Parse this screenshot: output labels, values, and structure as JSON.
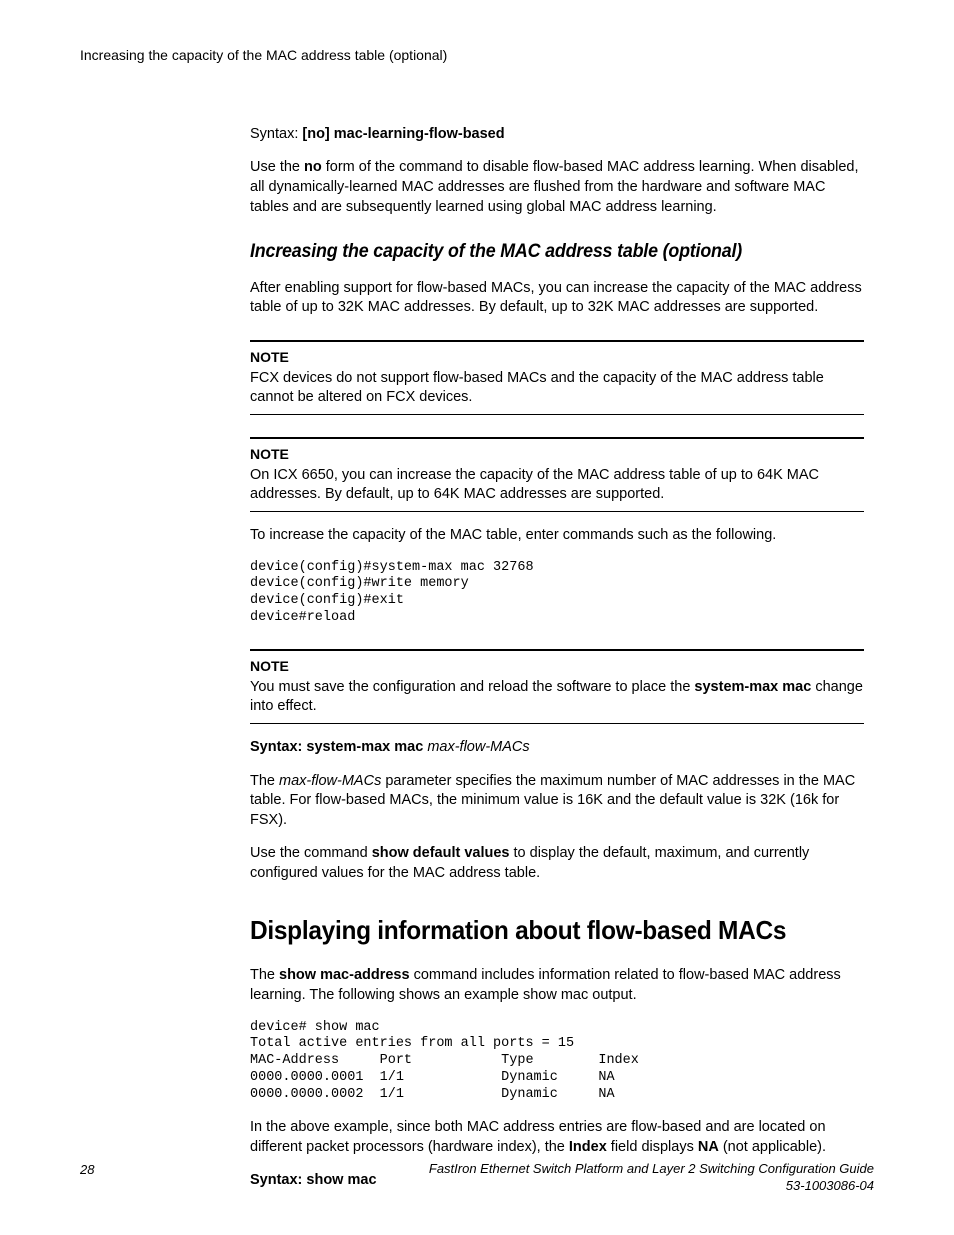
{
  "header": {
    "running_title": "Increasing the capacity of the MAC address table (optional)"
  },
  "block_syntax1": {
    "prefix": "Syntax: ",
    "bold": "[no] mac-learning-flow-based"
  },
  "para_useno_1": "Use the ",
  "para_useno_bold": "no",
  "para_useno_2": " form of the command to disable flow-based MAC address learning. When disabled, all dynamically-learned MAC addresses are flushed from the hardware and software MAC tables and are subsequently learned using global MAC address learning.",
  "section_heading": "Increasing the capacity of the MAC address table (optional)",
  "para_after_enabling": "After enabling support for flow-based MACs, you can increase the capacity of the MAC address table of up to 32K MAC addresses. By default, up to 32K MAC addresses are supported.",
  "note1": {
    "label": "NOTE",
    "body": "FCX devices do not support flow-based MACs and the capacity of the MAC address table cannot be altered on FCX devices."
  },
  "note2": {
    "label": "NOTE",
    "body": "On ICX 6650, you can increase the capacity of the MAC address table of up to 64K MAC addresses. By default, up to 64K MAC addresses are supported."
  },
  "para_to_increase": "To increase the capacity of the MAC table, enter commands such as the following.",
  "code1": "device(config)#system-max mac 32768\ndevice(config)#write memory\ndevice(config)#exit\ndevice#reload",
  "note3": {
    "label": "NOTE",
    "body_1": "You must save the configuration and reload the software to place the ",
    "body_bold": "system-max mac",
    "body_2": " change into effect."
  },
  "syntax2": {
    "bold": "Syntax: system-max mac",
    "italic": " max-flow-MACs"
  },
  "para_maxflow_1": "The ",
  "para_maxflow_italic": "max-flow-MACs",
  "para_maxflow_2": " parameter specifies the maximum number of MAC addresses in the MAC table. For flow-based MACs, the minimum value is 16K and the default value is 32K (16k for FSX).",
  "para_showdefault_1": "Use the command ",
  "para_showdefault_bold": "show default values",
  "para_showdefault_2": " to display the default, maximum, and currently configured values for the MAC address table.",
  "big_heading": "Displaying information about flow-based MACs",
  "para_showmac_1": "The ",
  "para_showmac_bold": "show mac-address",
  "para_showmac_2": " command includes information related to flow-based MAC address learning. The following shows an example show mac output.",
  "code2": "device# show mac\nTotal active entries from all ports = 15\nMAC-Address     Port           Type        Index\n0000.0000.0001  1/1            Dynamic     NA\n0000.0000.0002  1/1            Dynamic     NA",
  "para_example_1": "In the above example, since both MAC address entries are flow-based and are located on different packet processors (hardware index), the ",
  "para_example_bold1": "Index",
  "para_example_2": " field displays ",
  "para_example_bold2": "NA",
  "para_example_3": " (not applicable).",
  "syntax3": "Syntax: show mac",
  "footer": {
    "page": "28",
    "guide_title": "FastIron Ethernet Switch Platform and Layer 2 Switching Configuration Guide",
    "doc_number": "53-1003086-04"
  }
}
